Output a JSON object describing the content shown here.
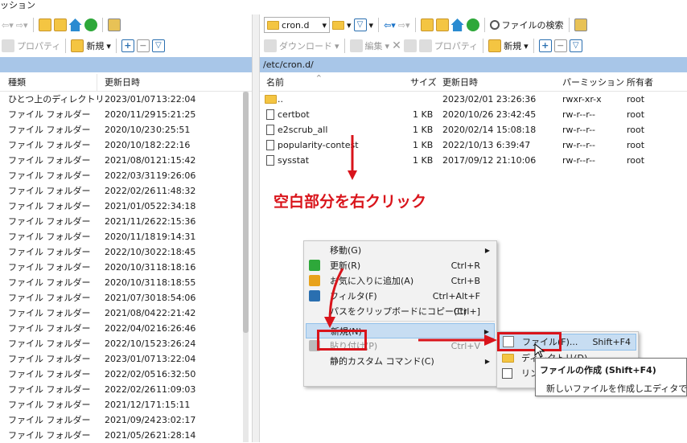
{
  "titlebar": {
    "title": "ッション"
  },
  "left_toolbar": {
    "properties": "プロパティ",
    "new": "新規"
  },
  "right_toolbar": {
    "dir_combo": "cron.d",
    "find_files": "ファイルの検索",
    "download": "ダウンロード",
    "edit": "編集",
    "properties": "プロパティ",
    "new": "新規"
  },
  "right_path": "/etc/cron.d/",
  "left_columns": {
    "type": "種類",
    "modified": "更新日時"
  },
  "left_rows": [
    {
      "type": "ひとつ上のディレクトリ",
      "date": "2023/01/07",
      "time": "13:22:04"
    },
    {
      "type": "ファイル フォルダー",
      "date": "2020/11/29",
      "time": "15:21:25"
    },
    {
      "type": "ファイル フォルダー",
      "date": "2020/10/23",
      "time": "0:25:51"
    },
    {
      "type": "ファイル フォルダー",
      "date": "2020/10/18",
      "time": "2:22:16"
    },
    {
      "type": "ファイル フォルダー",
      "date": "2021/08/01",
      "time": "21:15:42"
    },
    {
      "type": "ファイル フォルダー",
      "date": "2022/03/31",
      "time": "19:26:06"
    },
    {
      "type": "ファイル フォルダー",
      "date": "2022/02/26",
      "time": "11:48:32"
    },
    {
      "type": "ファイル フォルダー",
      "date": "2021/01/05",
      "time": "22:34:18"
    },
    {
      "type": "ファイル フォルダー",
      "date": "2021/11/26",
      "time": "22:15:36"
    },
    {
      "type": "ファイル フォルダー",
      "date": "2020/11/18",
      "time": "19:14:31"
    },
    {
      "type": "ファイル フォルダー",
      "date": "2022/10/30",
      "time": "22:18:45"
    },
    {
      "type": "ファイル フォルダー",
      "date": "2020/10/31",
      "time": "18:18:16"
    },
    {
      "type": "ファイル フォルダー",
      "date": "2020/10/31",
      "time": "18:18:55"
    },
    {
      "type": "ファイル フォルダー",
      "date": "2021/07/30",
      "time": "18:54:06"
    },
    {
      "type": "ファイル フォルダー",
      "date": "2021/08/04",
      "time": "22:21:42"
    },
    {
      "type": "ファイル フォルダー",
      "date": "2022/04/02",
      "time": "16:26:46"
    },
    {
      "type": "ファイル フォルダー",
      "date": "2022/10/15",
      "time": "23:26:24"
    },
    {
      "type": "ファイル フォルダー",
      "date": "2023/01/07",
      "time": "13:22:04"
    },
    {
      "type": "ファイル フォルダー",
      "date": "2022/02/05",
      "time": "16:32:50"
    },
    {
      "type": "ファイル フォルダー",
      "date": "2022/02/26",
      "time": "11:09:03"
    },
    {
      "type": "ファイル フォルダー",
      "date": "2021/12/17",
      "time": "1:15:11"
    },
    {
      "type": "ファイル フォルダー",
      "date": "2021/09/24",
      "time": "23:02:17"
    },
    {
      "type": "ファイル フォルダー",
      "date": "2021/05/26",
      "time": "21:28:14"
    }
  ],
  "right_columns": {
    "name": "名前",
    "size": "サイズ",
    "modified": "更新日時",
    "perm": "パーミッション",
    "owner": "所有者"
  },
  "right_rows": [
    {
      "name": "..",
      "size": "",
      "date": "2023/02/01 23:26:36",
      "perm": "rwxr-xr-x",
      "owner": "root",
      "icon": "parent-folder-icon"
    },
    {
      "name": "certbot",
      "size": "1 KB",
      "date": "2020/10/26 23:42:45",
      "perm": "rw-r--r--",
      "owner": "root",
      "icon": "file-icon"
    },
    {
      "name": "e2scrub_all",
      "size": "1 KB",
      "date": "2020/02/14 15:08:18",
      "perm": "rw-r--r--",
      "owner": "root",
      "icon": "file-icon"
    },
    {
      "name": "popularity-contest",
      "size": "1 KB",
      "date": "2022/10/13 6:39:47",
      "perm": "rw-r--r--",
      "owner": "root",
      "icon": "file-icon"
    },
    {
      "name": "sysstat",
      "size": "1 KB",
      "date": "2017/09/12 21:10:06",
      "perm": "rw-r--r--",
      "owner": "root",
      "icon": "file-icon"
    }
  ],
  "annotation": "空白部分を右クリック",
  "context_menu": [
    {
      "label": "移動(G)",
      "shortcut": "",
      "submenu": true
    },
    {
      "label": "更新(R)",
      "shortcut": "Ctrl+R"
    },
    {
      "label": "お気に入りに追加(A)",
      "shortcut": "Ctrl+B"
    },
    {
      "label": "フィルタ(F)",
      "shortcut": "Ctrl+Alt+F"
    },
    {
      "label": "パスをクリップボードにコピー(C)",
      "shortcut": "Ctrl+]"
    },
    {
      "label": "新規(N)",
      "shortcut": "",
      "submenu": true
    },
    {
      "label": "貼り付け(P)",
      "shortcut": "Ctrl+V"
    },
    {
      "label": "静的カスタム コマンド(C)",
      "shortcut": "",
      "submenu": true
    }
  ],
  "submenu": {
    "file_label": "ファイル(F)...",
    "file_shortcut": "Shift+F4",
    "dir_label": "ディレクトリ(D)...",
    "link_label": "リンク(L)..."
  },
  "tooltip": {
    "title": "ファイルの作成 (Shift+F4)",
    "desc": "新しいファイルを作成しエディタで開く"
  },
  "colors": {
    "path_bar": "#a8c6e8",
    "highlight": "#c7ddf2",
    "annotation_red": "#d9141b"
  }
}
